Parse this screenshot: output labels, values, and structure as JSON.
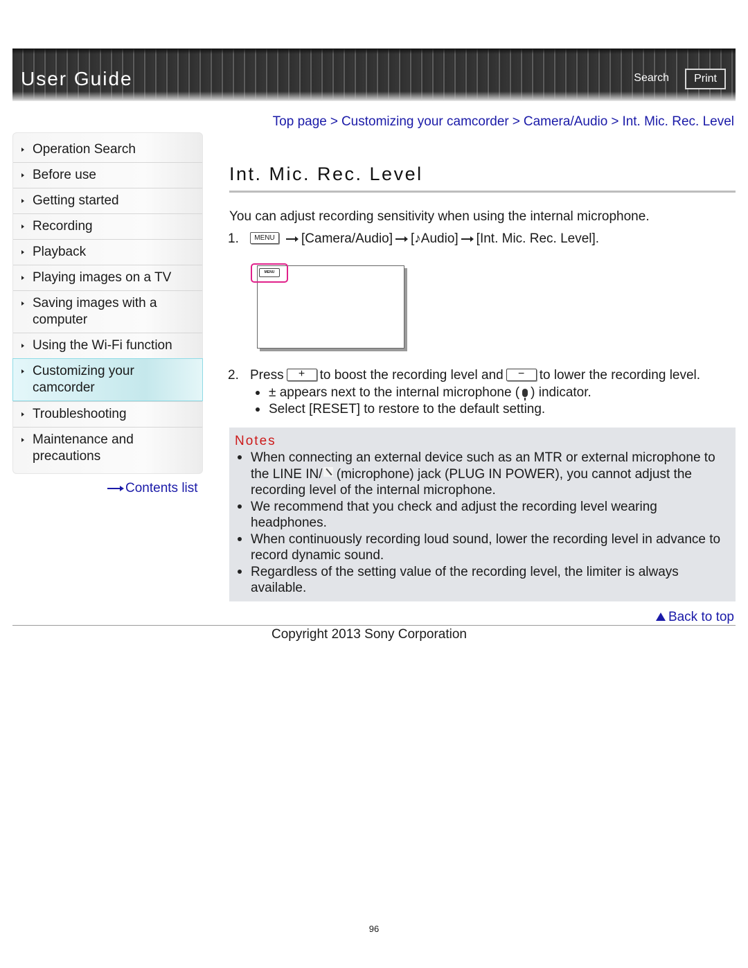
{
  "header": {
    "title": "User Guide",
    "search_label": "Search",
    "print_label": "Print"
  },
  "breadcrumb": [
    "Top page",
    "Customizing your camcorder",
    "Camera/Audio",
    "Int. Mic. Rec. Level"
  ],
  "breadcrumb_separator": ">",
  "sidebar": {
    "items": [
      {
        "label": "Operation Search",
        "active": false
      },
      {
        "label": "Before use",
        "active": false
      },
      {
        "label": "Getting started",
        "active": false
      },
      {
        "label": "Recording",
        "active": false
      },
      {
        "label": "Playback",
        "active": false
      },
      {
        "label": "Playing images on a TV",
        "active": false
      },
      {
        "label": "Saving images with a computer",
        "active": false
      },
      {
        "label": "Using the Wi-Fi function",
        "active": false
      },
      {
        "label": "Customizing your camcorder",
        "active": true
      },
      {
        "label": "Troubleshooting",
        "active": false
      },
      {
        "label": "Maintenance and precautions",
        "active": false
      }
    ],
    "contents_link": "Contents list"
  },
  "main": {
    "title": "Int. Mic. Rec. Level",
    "intro": "You can adjust recording sensitivity when using the internal microphone.",
    "step1": {
      "num": "1.",
      "menu_key": "MENU",
      "path": [
        "[Camera/Audio]",
        "[♪Audio]",
        "[Int. Mic. Rec. Level]."
      ]
    },
    "illustration": {
      "menu_key": "MENU"
    },
    "step2": {
      "num": "2.",
      "press": "Press",
      "plus_key": "+",
      "mid": "to boost the recording level and",
      "minus_key": "−",
      "end": "to lower the recording level."
    },
    "step2_bullets": {
      "b1_pre": "± appears next to the internal microphone (",
      "b1_post": ") indicator.",
      "b2": "Select [RESET] to restore to the default setting."
    },
    "notes": {
      "title": "Notes",
      "n1_pre": "When connecting an external device such as an MTR or external microphone to the LINE IN/",
      "n1_post": " (microphone) jack (PLUG IN POWER), you cannot adjust the recording level of the internal microphone.",
      "n2": "We recommend that you check and adjust the recording level wearing headphones.",
      "n3": "When continuously recording loud sound, lower the recording level in advance to record dynamic sound.",
      "n4": "Regardless of the setting value of the recording level, the limiter is always available."
    }
  },
  "footer": {
    "back_to_top": "Back to top",
    "copyright": "Copyright 2013 Sony Corporation",
    "page_number": "96"
  },
  "colors": {
    "link": "#1a1aa8",
    "notes_title": "#cc1a1a",
    "notes_bg": "#e2e4e8",
    "active_nav_border": "#8fdbe6",
    "highlight": "#e0218a"
  }
}
